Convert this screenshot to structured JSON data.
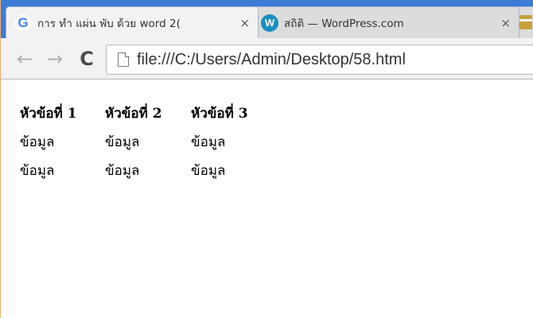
{
  "browser": {
    "tabs": [
      {
        "favicon": "google-icon",
        "favicon_glyph": "G",
        "title": "การ ทำ แผ่น พับ ด้วย word 2(",
        "close": "×",
        "active": true
      },
      {
        "favicon": "wordpress-icon",
        "favicon_glyph": "W",
        "title": "สถิติ — WordPress.com",
        "close": "×",
        "active": false
      }
    ],
    "toolbar": {
      "back": "←",
      "forward": "→",
      "reload": "C",
      "url": "file:///C:/Users/Admin/Desktop/58.html"
    },
    "accent_colors": {
      "tabstrip": "#3c7bd6",
      "window_border": "#f0b070"
    }
  },
  "page": {
    "table": {
      "headers": [
        "หัวข้อที่ 1",
        "หัวข้อที่ 2",
        "หัวข้อที่ 3"
      ],
      "rows": [
        [
          "ข้อมูล",
          "ข้อมูล",
          "ข้อมูล"
        ],
        [
          "ข้อมูล",
          "ข้อมูล",
          "ข้อมูล"
        ]
      ]
    }
  }
}
